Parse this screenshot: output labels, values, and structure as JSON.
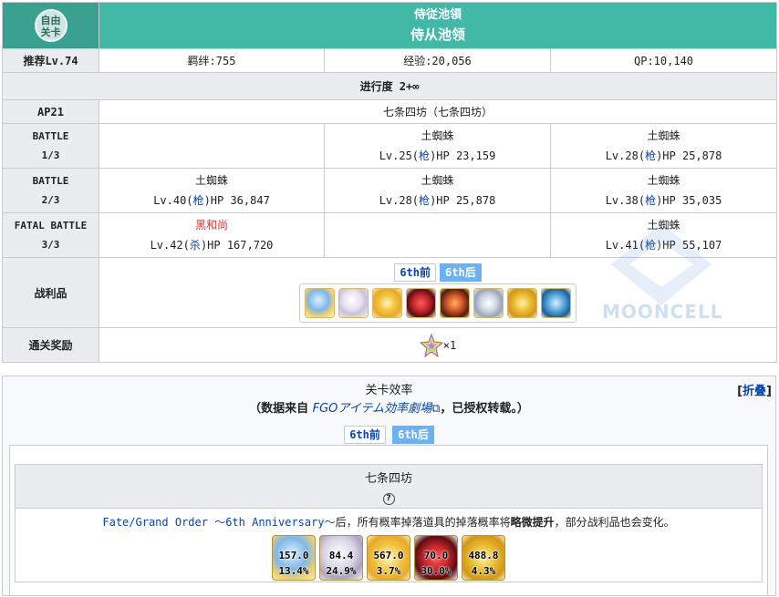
{
  "header": {
    "badge_line1": "自由",
    "badge_line2": "关卡",
    "title_jp": "侍従池領",
    "title_cn": "侍从池领"
  },
  "info": {
    "recommend": "推荐Lv.74",
    "bond": "羁绊:755",
    "exp": "经验:20,056",
    "qp": "QP:10,140"
  },
  "progress": "进行度 2+∞",
  "ap": {
    "label": "AP21",
    "location": "七条四坊（七条四坊）"
  },
  "battles": [
    {
      "label1": "BATTLE",
      "label2": "1/3",
      "enemies": [
        null,
        {
          "name": "土蜘蛛",
          "lv": "Lv.25(",
          "cls": "枪",
          "hp": ")HP 23,159"
        },
        {
          "name": "土蜘蛛",
          "lv": "Lv.28(",
          "cls": "枪",
          "hp": ")HP 25,878"
        }
      ]
    },
    {
      "label1": "BATTLE",
      "label2": "2/3",
      "enemies": [
        {
          "name": "土蜘蛛",
          "lv": "Lv.40(",
          "cls": "枪",
          "hp": ")HP 36,847"
        },
        {
          "name": "土蜘蛛",
          "lv": "Lv.28(",
          "cls": "枪",
          "hp": ")HP 25,878"
        },
        {
          "name": "土蜘蛛",
          "lv": "Lv.38(",
          "cls": "枪",
          "hp": ")HP 35,035"
        }
      ]
    },
    {
      "label1": "FATAL BATTLE",
      "label2": "3/3",
      "enemies": [
        {
          "name": "黑和尚",
          "lv": "Lv.42(",
          "cls": "杀",
          "hp": ")HP 167,720"
        },
        null,
        {
          "name": "土蜘蛛",
          "lv": "Lv.41(",
          "cls": "枪",
          "hp": ")HP 55,107"
        }
      ]
    }
  ],
  "loot": {
    "label": "战利品",
    "tab_before": "6th前",
    "tab_after": "6th后",
    "items": [
      "blue-orb-icon",
      "pearl-icon",
      "gold-gear-icon",
      "red-gem-icon",
      "flame-claw-icon",
      "silver-shard-icon",
      "gold-coin-icon",
      "blue-crystal-icon"
    ]
  },
  "reward": {
    "label": "通关奖励",
    "count": "×1"
  },
  "efficiency": {
    "title": "关卡效率",
    "source_prefix": "（数据来自 ",
    "source_name": "FGOアイテム効率劇場",
    "source_suffix": "，已授权转载。）",
    "fold": "折叠",
    "tab_before": "6th前",
    "tab_after": "6th后",
    "card_title": "七条四坊",
    "help": "?",
    "note_link": "Fate/Grand Order ～6th Anniversary～",
    "note_after": "后，所有概率掉落道具的掉落概率将",
    "note_bold": "略微提升",
    "note_tail": "，部分战利品也会变化。",
    "drops": [
      {
        "icon": "blue-orb-icon",
        "ap": "157.0",
        "rate": "13.4%",
        "color": "#7fb7e8"
      },
      {
        "icon": "pearl-icon",
        "ap": "84.4",
        "rate": "24.9%",
        "color": "#d8d4e4"
      },
      {
        "icon": "gold-gear-icon",
        "ap": "567.0",
        "rate": "3.7%",
        "color": "#f1c43e"
      },
      {
        "icon": "red-gem-icon",
        "ap": "70.0",
        "rate": "30.0%",
        "color": "#c4262b"
      },
      {
        "icon": "gold-coin-icon",
        "ap": "488.8",
        "rate": "4.3%",
        "color": "#e8b82b"
      }
    ]
  },
  "watermark": "MOONCELL"
}
